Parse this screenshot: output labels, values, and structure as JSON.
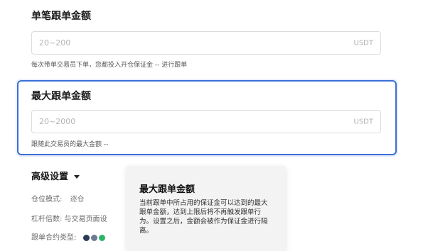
{
  "single": {
    "title": "单笔跟单金额",
    "placeholder": "20~200",
    "unit": "USDT",
    "hint": "每次带单交易员下单，您都投入开仓保证金 -- 进行跟单"
  },
  "max": {
    "title": "最大跟单金额",
    "placeholder": "20~2000",
    "unit": "USDT",
    "hint": "跟随此交易员的最大金额 --"
  },
  "advanced": {
    "label": "高级设置",
    "position_mode_label": "仓位模式:",
    "position_mode_value": "逐仓",
    "leverage_label": "杠杆倍数: 与交易页面设",
    "contract_label": "跟单合约类型:"
  },
  "tooltip": {
    "title": "最大跟单金额",
    "body": "当前跟单中所占用的保证金可以达到的最大跟单金额，达到上限后将不再触发跟单行为。设置之后，金额会被作为保证金进行隔离。"
  }
}
